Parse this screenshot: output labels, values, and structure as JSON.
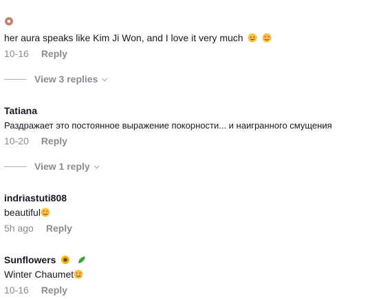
{
  "comments": [
    {
      "text": "her aura speaks like Kim Ji Won, and I love it very much",
      "date": "10-16",
      "reply": "Reply",
      "replies_label": "View 3 replies"
    },
    {
      "user": "Tatiana",
      "text": "Раздражает это постоянное выражение покорности... и наигранного смущения",
      "date": "10-20",
      "reply": "Reply",
      "replies_label": "View 1 reply"
    },
    {
      "user": "indriastuti808",
      "text": "beautiful",
      "date": "5h ago",
      "reply": "Reply"
    },
    {
      "user": "Sunflowers",
      "text": "Winter Chaumet",
      "date": "10-16",
      "reply": "Reply"
    }
  ],
  "icons": {
    "chevron": "chevron-down-icon",
    "emojis": [
      "donut-emoji",
      "smiling-face-emoji",
      "heart-eyes-emoji",
      "sunflower-emoji",
      "leaf-emoji"
    ]
  },
  "colors": {
    "text": "#161823",
    "muted": "#8a8b91"
  }
}
